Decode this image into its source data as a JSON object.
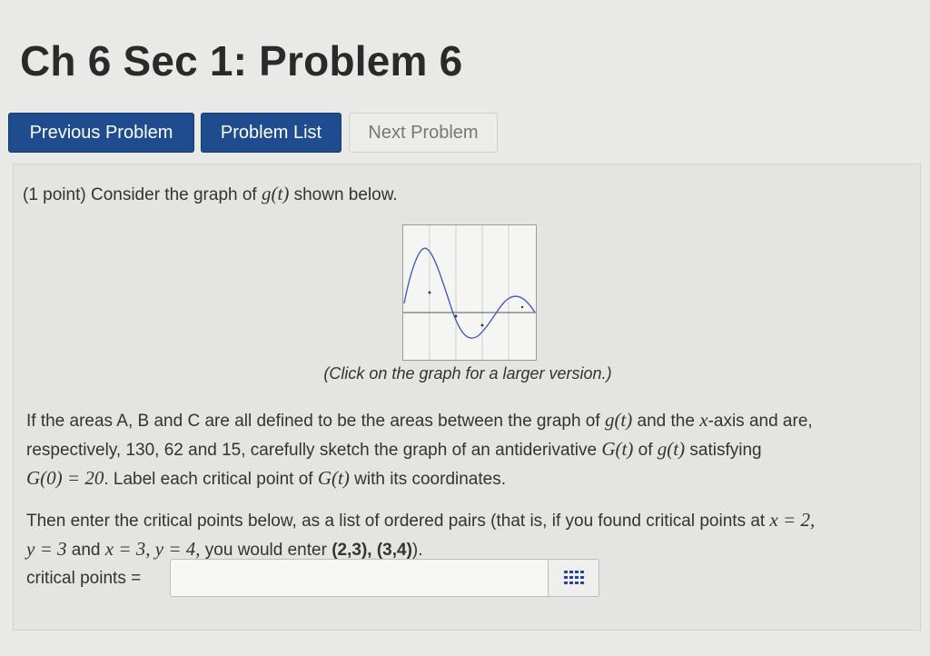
{
  "header": {
    "title": "Ch 6 Sec 1: Problem 6"
  },
  "nav": {
    "previous": "Previous Problem",
    "list": "Problem List",
    "next": "Next Problem"
  },
  "problem": {
    "intro_prefix": "(1 point) Consider the graph of ",
    "intro_func": "g(t)",
    "intro_suffix": " shown below.",
    "caption": "(Click on the graph for a larger version.)",
    "p1": {
      "t1": "If the areas A, B and C are all defined to be the areas between the graph of ",
      "m1": "g(t)",
      "t2": " and the ",
      "m2": "x",
      "t3": "-axis and are, respectively, 130, 62 and 15, carefully sketch the graph of an antiderivative ",
      "m3": "G(t)",
      "t4": " of ",
      "m4": "g(t)",
      "t5": " satisfying ",
      "m5": "G(0) = 20",
      "t6": ". Label each critical point of ",
      "m6": "G(t)",
      "t7": " with its coordinates."
    },
    "p2": {
      "t1": "Then enter the critical points below, as a list of ordered pairs (that is, if you found critical points at ",
      "m1": "x = 2,",
      "m2": "y = 3",
      "t2": " and ",
      "m3": "x = 3, y = 4,",
      "t3": " you would enter ",
      "example": "(2,3), (3,4)",
      "t4": ")."
    },
    "answer_label": "critical points =",
    "answer_value": ""
  },
  "colors": {
    "primary_button": "#1e4c8f",
    "curve": "#3b56c4"
  },
  "icons": {
    "palette": "grid-palette-icon"
  }
}
